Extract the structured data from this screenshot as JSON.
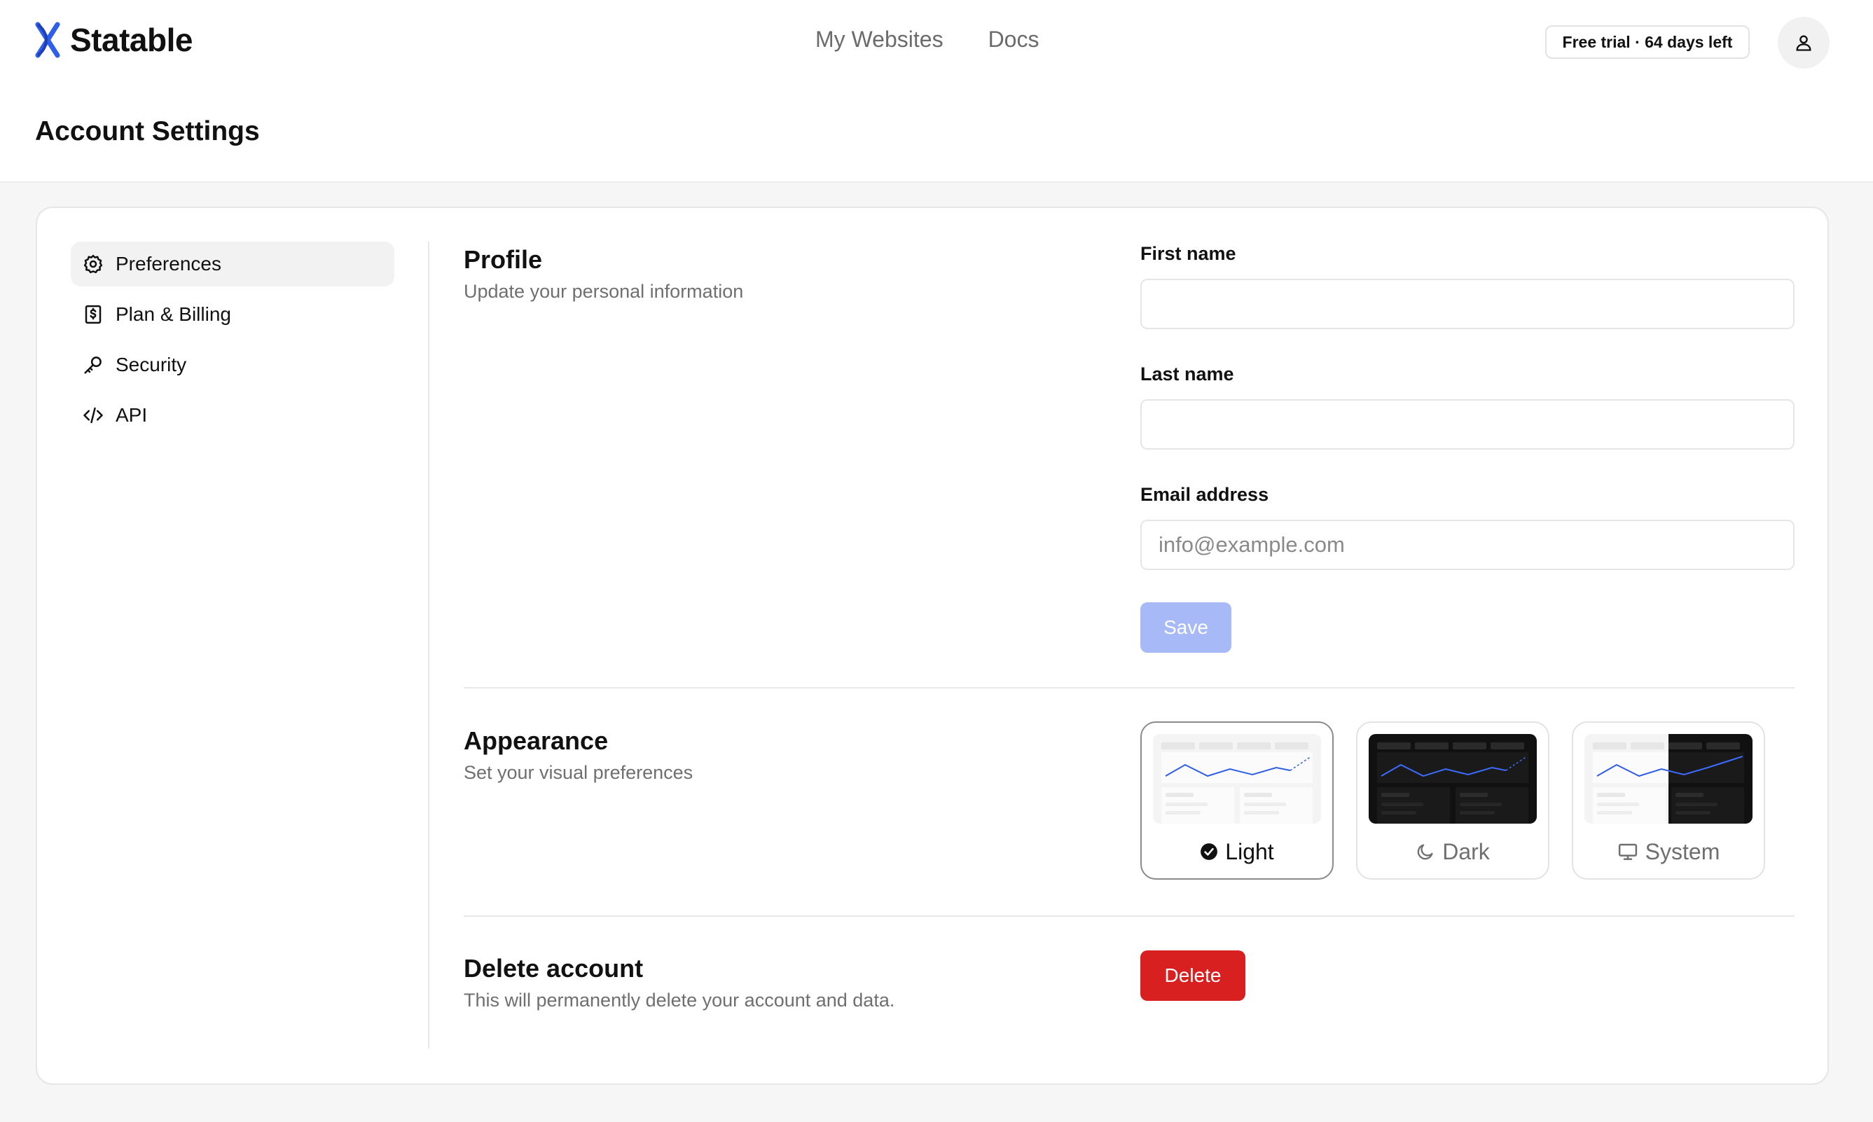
{
  "app": {
    "name": "Statable",
    "accent_color": "#2f5ee8",
    "logo_icon": "statable-logo-icon"
  },
  "nav": {
    "items": [
      {
        "label": "My Websites"
      },
      {
        "label": "Docs"
      }
    ]
  },
  "trial": {
    "label": "Free trial · 64 days left"
  },
  "user_menu": {
    "icon": "user-icon"
  },
  "page": {
    "title": "Account Settings"
  },
  "sidebar": {
    "items": [
      {
        "label": "Preferences",
        "icon": "gear-icon",
        "active": true
      },
      {
        "label": "Plan & Billing",
        "icon": "dollar-receipt-icon",
        "active": false
      },
      {
        "label": "Security",
        "icon": "key-icon",
        "active": false
      },
      {
        "label": "API",
        "icon": "code-icon",
        "active": false
      }
    ]
  },
  "profile": {
    "title": "Profile",
    "subtitle": "Update your personal information",
    "first_name_label": "First name",
    "first_name_value": "",
    "last_name_label": "Last name",
    "last_name_value": "",
    "email_label": "Email address",
    "email_value": "",
    "email_placeholder": "info@example.com",
    "save_label": "Save",
    "save_color": "#a7b9f7"
  },
  "appearance": {
    "title": "Appearance",
    "subtitle": "Set your visual preferences",
    "options": [
      {
        "label": "Light",
        "icon": "check-circle-icon",
        "selected": true
      },
      {
        "label": "Dark",
        "icon": "moon-icon",
        "selected": false
      },
      {
        "label": "System",
        "icon": "monitor-icon",
        "selected": false
      }
    ]
  },
  "delete_account": {
    "title": "Delete account",
    "subtitle": "This will permanently delete your account and data.",
    "button_label": "Delete",
    "button_color": "#d92020"
  }
}
